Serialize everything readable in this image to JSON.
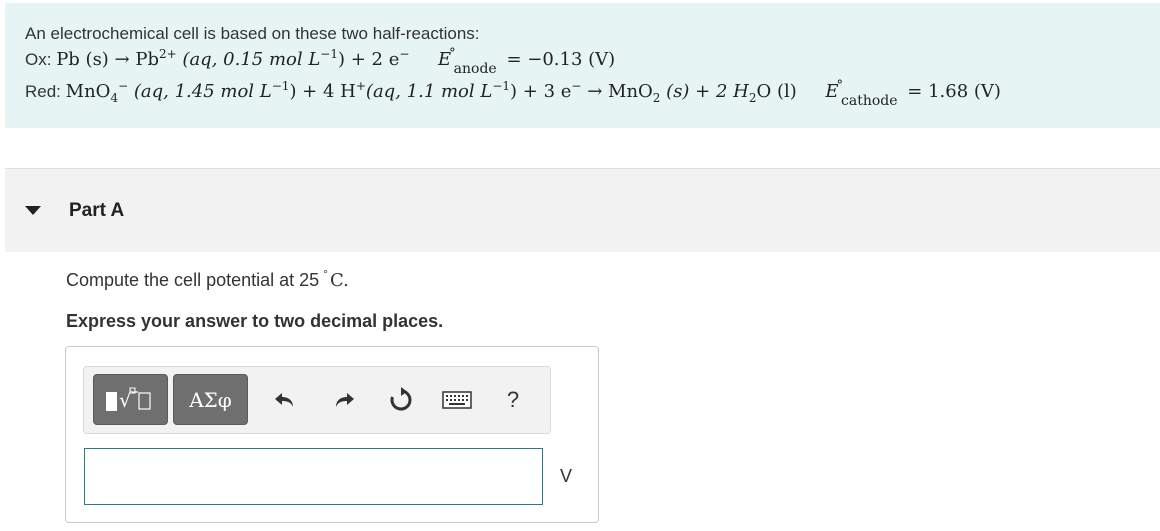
{
  "problem": {
    "intro": "An electrochemical cell is based on these two half-reactions:",
    "ox": {
      "label": "Ox:",
      "lhs": "Pb (s) → Pb",
      "ion_charge": "2+",
      "conditions": "(aq, 0.15 mol L",
      "unit_exp": "−1",
      "close": ") + 2 e",
      "e_charge": "−",
      "E": "E",
      "E_sup": "°",
      "E_sub": "anode",
      "value": "= −0.13 (V)"
    },
    "red": {
      "label": "Red:",
      "species1": "MnO",
      "species1_sub": "4",
      "species1_sup": "−",
      "cond1": "(aq, 1.45 mol L",
      "cond1_exp": "−1",
      "mid": ") + 4 H",
      "h_sup": "+",
      "cond2": "(aq, 1.1 mol L",
      "cond2_exp": "−1",
      "tail": ") + 3 e",
      "e_sup": "−",
      "arrow_product": "→ MnO",
      "product_sub": "2",
      "product_rest": "(s) + 2 H",
      "water_sub": "2",
      "water_rest": "O (l)",
      "E": "E",
      "E_sup": "°",
      "E_sub": "cathode",
      "value": "= 1.68 (V)"
    }
  },
  "part": {
    "title": "Part A"
  },
  "question": {
    "text_before": "Compute the cell potential at 25",
    "deg": "°",
    "text_after": "C.",
    "instruction": "Express your answer to two decimal places."
  },
  "toolbar": {
    "greek_label": "ΑΣφ",
    "help_label": "?",
    "icons": [
      "templates-icon",
      "greek-icon",
      "undo-icon",
      "redo-icon",
      "reset-icon",
      "keyboard-icon",
      "help-icon"
    ]
  },
  "answer": {
    "value": "",
    "unit": "V"
  },
  "colors": {
    "problem_bg": "#e6f4f4",
    "part_bg": "#f2f2f2",
    "button_bg": "#6f6f6f",
    "input_border": "#2b7a8a"
  }
}
